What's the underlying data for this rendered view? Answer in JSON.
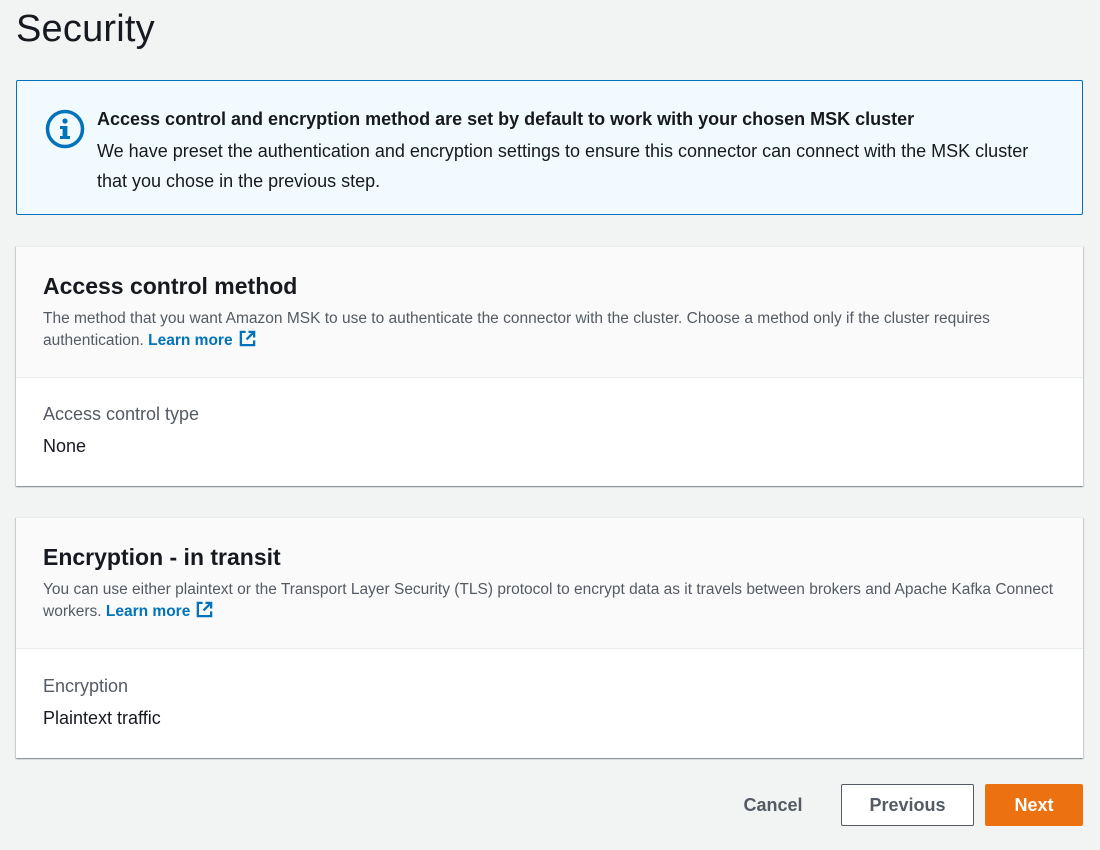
{
  "page": {
    "title": "Security"
  },
  "alert": {
    "title": "Access control and encryption method are set by default to work with your chosen MSK cluster",
    "body": "We have preset the authentication and encryption settings to ensure this connector can connect with the MSK cluster that you chose in the previous step.",
    "icon": "info-icon",
    "accent": "#0073bb"
  },
  "access_control": {
    "title": "Access control method",
    "description": "The method that you want Amazon MSK to use to authenticate the connector with the cluster. Choose a method only if the cluster requires authentication.",
    "learn_more": "Learn more",
    "field_label": "Access control type",
    "field_value": "None"
  },
  "encryption": {
    "title": "Encryption - in transit",
    "description": "You can use either plaintext or the Transport Layer Security (TLS) protocol to encrypt data as it travels between brokers and Apache Kafka Connect workers.",
    "learn_more": "Learn more",
    "field_label": "Encryption",
    "field_value": "Plaintext traffic"
  },
  "footer": {
    "cancel": "Cancel",
    "previous": "Previous",
    "next": "Next",
    "primary_color": "#ec7211"
  },
  "icons": {
    "external_link": "external-link-icon"
  }
}
